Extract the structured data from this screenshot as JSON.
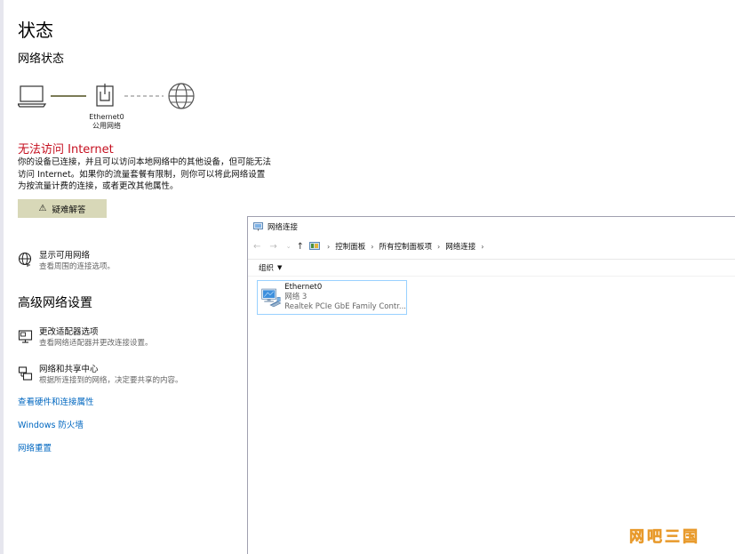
{
  "page": {
    "title": "状态",
    "subtitle": "网络状态"
  },
  "network": {
    "adapter_name": "Ethernet0",
    "profile": "公用网络",
    "status_title": "无法访问 Internet",
    "status_desc": "你的设备已连接，并且可以访问本地网络中的其他设备，但可能无法访问 Internet。如果你的流量套餐有限制，则你可以将此网络设置为按流量计费的连接，或者更改其他属性。",
    "troubleshoot_label": "疑难解答"
  },
  "show_networks": {
    "title": "显示可用网络",
    "desc": "查看周围的连接选项。"
  },
  "advanced": {
    "heading": "高级网络设置",
    "adapter_options": {
      "title": "更改适配器选项",
      "desc": "查看网络适配器并更改连接设置。"
    },
    "sharing_center": {
      "title": "网络和共享中心",
      "desc": "根据所连接到的网络，决定要共享的内容。"
    },
    "links": [
      "查看硬件和连接属性",
      "Windows 防火墙",
      "网络重置"
    ]
  },
  "explorer": {
    "title": "网络连接",
    "breadcrumb": [
      "控制面板",
      "所有控制面板项",
      "网络连接"
    ],
    "toolbar_organize": "组织",
    "item": {
      "name": "Ethernet0",
      "network": "网络 3",
      "adapter": "Realtek PCIe GbE Family Contr..."
    }
  },
  "watermark": "网吧三国",
  "colors": {
    "error": "#c50f1f",
    "link": "#0067c0",
    "button_bg": "#d8d8b8",
    "selection_border": "#99d1ff"
  }
}
